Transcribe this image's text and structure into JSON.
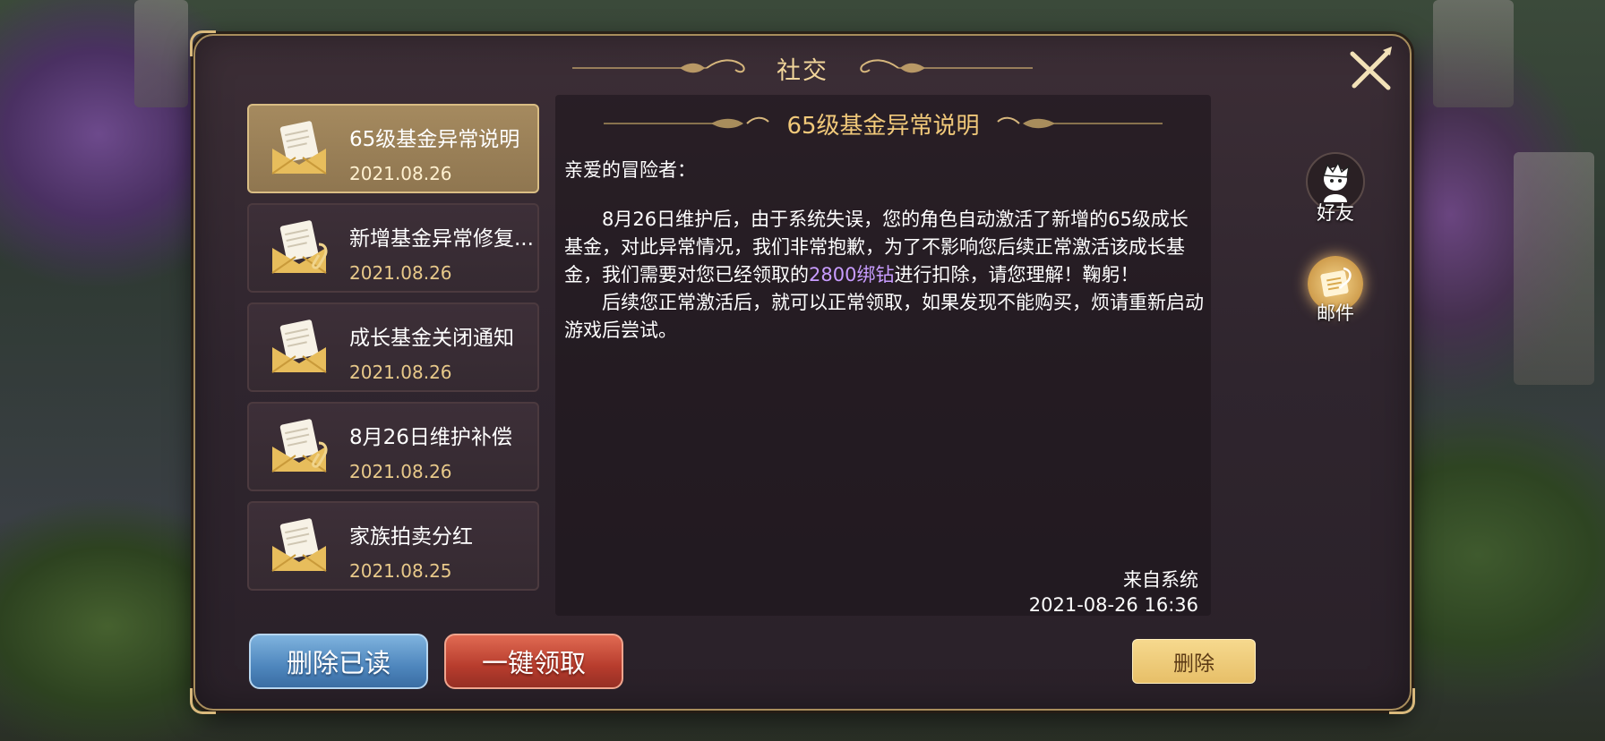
{
  "window": {
    "title": "社交"
  },
  "mail_list": [
    {
      "title": "65级基金异常说明",
      "date": "2021.08.26",
      "has_attachment": false,
      "selected": true
    },
    {
      "title": "新增基金异常修复...",
      "date": "2021.08.26",
      "has_attachment": true,
      "selected": false
    },
    {
      "title": "成长基金关闭通知",
      "date": "2021.08.26",
      "has_attachment": false,
      "selected": false
    },
    {
      "title": "8月26日维护补偿",
      "date": "2021.08.26",
      "has_attachment": true,
      "selected": false
    },
    {
      "title": "家族拍卖分红",
      "date": "2021.08.25",
      "has_attachment": false,
      "selected": false
    }
  ],
  "mail": {
    "title": "65级基金异常说明",
    "greeting": "亲爱的冒险者：",
    "paragraph1_before": "8月26日维护后，由于系统失误，您的角色自动激活了新增的65级成长基金，对此异常情况，我们非常抱歉，为了不影响您后续正常激活该成长基金，我们需要对您已经领取的",
    "paragraph1_highlight": "2800绑钻",
    "paragraph1_after": "进行扣除，请您理解！鞠躬！",
    "paragraph2": "后续您正常激活后，就可以正常领取，如果发现不能购买，烦请重新启动游戏后尝试。",
    "sender": "来自系统",
    "timestamp": "2021-08-26  16:36"
  },
  "side_tabs": {
    "friends": "好友",
    "mail": "邮件"
  },
  "buttons": {
    "delete_read": "删除已读",
    "claim_all": "一键领取",
    "delete": "删除"
  },
  "colors": {
    "accent_gold": "#f1c97a",
    "highlight_purple": "#c89cff",
    "panel_bg": "#2f252e"
  },
  "icons": {
    "close": "close-x-icon",
    "mail": "envelope-icon",
    "attachment": "paperclip-icon",
    "friends": "friend-avatar-icon",
    "mail_tab": "letter-quill-icon"
  }
}
